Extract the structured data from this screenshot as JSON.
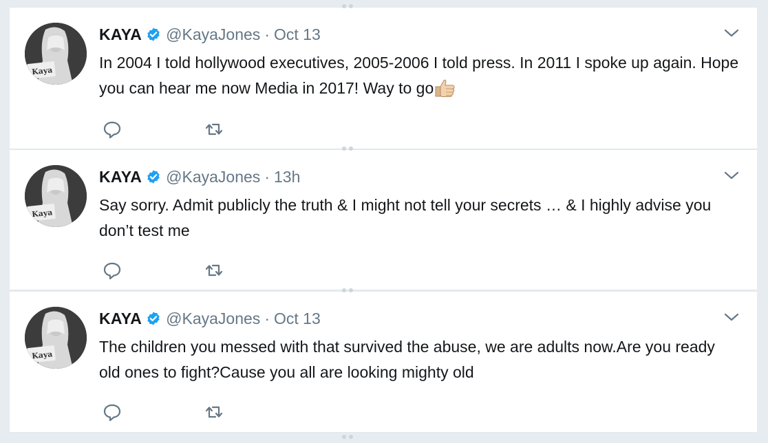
{
  "tweets": [
    {
      "name": "KAYA",
      "handle": "@KayaJones",
      "separator": "·",
      "time": "Oct 13",
      "avatar_label": "Kaya",
      "text": "In 2004 I told hollywood executives, 2005-2006 I told press. In 2011 I spoke up again. Hope you can hear me now Media in 2017! Way to go",
      "emoji": "thumbs-up-emoji"
    },
    {
      "name": "KAYA",
      "handle": "@KayaJones",
      "separator": "·",
      "time": "13h",
      "avatar_label": "Kaya",
      "text": "Say sorry. Admit publicly the truth & I might not tell your secrets … & I highly advise you don’t test me"
    },
    {
      "name": "KAYA",
      "handle": "@KayaJones",
      "separator": "·",
      "time": "Oct 13",
      "avatar_label": "Kaya",
      "text": "The children you messed with that survived the abuse, we are adults now.Are you ready old ones to fight?Cause you all are looking mighty old"
    }
  ],
  "colors": {
    "background": "#e6ecf0",
    "card": "#ffffff",
    "text": "#14171a",
    "secondary": "#657786",
    "verified": "#1da1f2"
  },
  "icons": {
    "verified": "verified-badge-icon",
    "caret": "chevron-down-icon",
    "reply": "reply-icon",
    "retweet": "retweet-icon"
  }
}
